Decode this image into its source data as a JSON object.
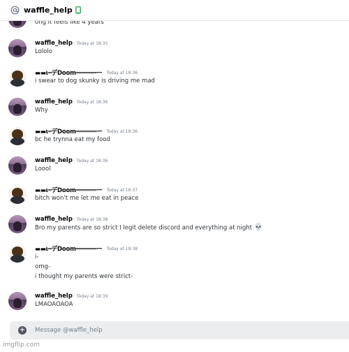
{
  "header": {
    "title": "waffle_help",
    "at_icon": "at-icon",
    "status_icon": "mobile-icon"
  },
  "users": {
    "waffle": "waffle_help",
    "doom": "▬▬ι═デDoom══════ー"
  },
  "messages": [
    {
      "author": "waffle",
      "time": "",
      "lines": [
        "ong it feels like 4 years"
      ],
      "partial": true
    },
    {
      "author": "waffle",
      "time": "Today at 18:35",
      "lines": [
        "Lololo"
      ]
    },
    {
      "author": "doom",
      "time": "Today at 18:36",
      "lines": [
        "i swear to dog skunky is driving me mad"
      ]
    },
    {
      "author": "waffle",
      "time": "Today at 18:36",
      "lines": [
        "Why"
      ]
    },
    {
      "author": "doom",
      "time": "Today at 18:36",
      "lines": [
        "bc he trynna eat my food"
      ]
    },
    {
      "author": "waffle",
      "time": "Today at 18:36",
      "lines": [
        "Loool"
      ]
    },
    {
      "author": "doom",
      "time": "Today at 18:37",
      "lines": [
        "bitch won't me let me eat in peace"
      ]
    },
    {
      "author": "waffle",
      "time": "Today at 18:38",
      "lines": [
        "Bro my parents are so strict I legit delete discord and everything at night"
      ],
      "emoji": "💀"
    },
    {
      "author": "doom",
      "time": "Today at 18:38",
      "lines": [
        "i-",
        "omg-",
        "i thought my parents were strict-"
      ]
    },
    {
      "author": "waffle",
      "time": "Today at 18:39",
      "lines": [
        "LMAOAOAOA"
      ]
    }
  ],
  "composer": {
    "placeholder": "Message @waffle_help",
    "plus_icon": "add-attachment-icon"
  },
  "watermark": "imgflip.com",
  "colors": {
    "background": "#ffffff",
    "composer_bg": "#ebedef",
    "timestamp": "#747f8d",
    "text": "#2e3338",
    "online_mobile": "#3ba55d"
  }
}
